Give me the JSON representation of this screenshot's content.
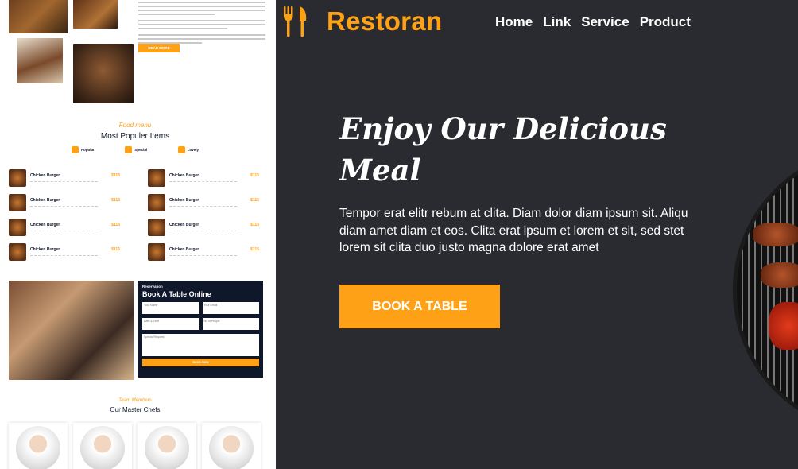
{
  "preview": {
    "read_more": "READ MORE",
    "food_subtitle": "Food menu",
    "food_title": "Most Populer Items",
    "tabs": [
      {
        "label": "Popular"
      },
      {
        "label": "Special"
      },
      {
        "label": "Lovely"
      }
    ],
    "menu_items": [
      {
        "name": "Chicken Burger",
        "price": "$115"
      },
      {
        "name": "Chicken Burger",
        "price": "$115"
      },
      {
        "name": "Chicken Burger",
        "price": "$115"
      },
      {
        "name": "Chicken Burger",
        "price": "$115"
      },
      {
        "name": "Chicken Burger",
        "price": "$115"
      },
      {
        "name": "Chicken Burger",
        "price": "$115"
      },
      {
        "name": "Chicken Burger",
        "price": "$115"
      },
      {
        "name": "Chicken Burger",
        "price": "$115"
      }
    ],
    "reservation": {
      "label": "Reservation",
      "title": "Book A Table Online",
      "name_placeholder": "Your Name",
      "email_placeholder": "Your Email",
      "date_placeholder": "Date & Time",
      "people_placeholder": "No of People",
      "request_placeholder": "Special Request",
      "book_label": "BOOK NOW"
    },
    "team_subtitle": "Team Members",
    "team_title": "Our Master Chefs"
  },
  "header": {
    "brand": "Restoran",
    "nav": [
      "Home",
      "Link",
      "Service",
      "Product"
    ]
  },
  "hero": {
    "headline": "Enjoy Our Delicious Meal",
    "lead": "Tempor erat elitr rebum at clita. Diam dolor diam ipsum sit. Aliqu diam amet diam et eos. Clita erat ipsum et lorem et sit, sed stet lorem sit clita duo justo magna dolore erat amet",
    "cta": "BOOK A TABLE"
  },
  "colors": {
    "accent": "#fea116",
    "dark": "#2a2b30",
    "navy": "#0f172b"
  },
  "icons": {
    "brand": "utensils-icon"
  }
}
